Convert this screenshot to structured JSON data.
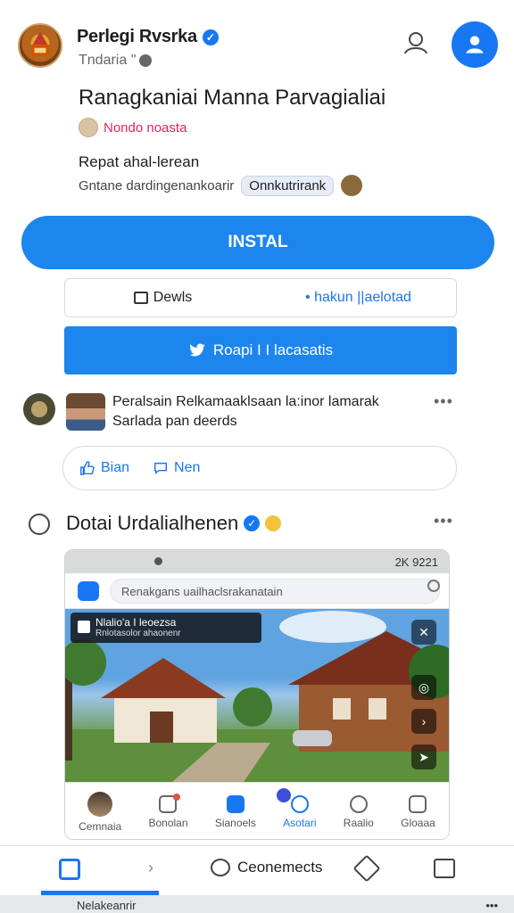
{
  "header": {
    "app_name": "Perlegi Rvsrka",
    "verified_icon": "verified-check-icon",
    "subtitle": "Tndaria \"",
    "globe_icon": "globe-icon",
    "profile_icon": "person-outline-icon",
    "account_icon": "person-circle-icon"
  },
  "headline": "Ranagkaniai Manna Parvagialiai",
  "tag_line": "Nondo noasta",
  "description": {
    "line1": "Repat ahal-lerean",
    "line2": "Gntane dardingenankoarir",
    "pill": "Onnkutrirank"
  },
  "install_button": "INSTAL",
  "split_box": {
    "left_label": "Dewls",
    "left_icon": "copy-icon",
    "right_label": "• hakun ||aelotad"
  },
  "share_button": {
    "label": "Roapi I I lacasatis",
    "icon": "bird-icon"
  },
  "post": {
    "line1": "Peralsain Relkamaaklsaan la:inor lamarak",
    "line2": "Sarlada pan deerds",
    "more": "•••"
  },
  "reactions": {
    "like_label": "Bian",
    "like_icon": "thumbs-up-icon",
    "comment_label": "Nen",
    "comment_icon": "speech-bubble-icon"
  },
  "section": {
    "title": "Dotai Urdalialhenen",
    "clock_icon": "clock-icon",
    "more": "•••"
  },
  "embedded": {
    "status_time": "2K 9221",
    "url_text": "Renakgans uailhaclsrakanatain",
    "banner_title": "Nlalio'a I leoezsa",
    "banner_sub": "Rnlotasolor ahaonenr",
    "nav": [
      {
        "label": "Cemnaia",
        "icon": "avatar-icon"
      },
      {
        "label": "Bonolan",
        "icon": "chat-add-icon"
      },
      {
        "label": "Sianoels",
        "icon": "message-icon"
      },
      {
        "label": "Asotari",
        "icon": "people-icon"
      },
      {
        "label": "Raalio",
        "icon": "heart-outline-icon"
      },
      {
        "label": "Gloaaa",
        "icon": "square-icon"
      }
    ]
  },
  "bottom_nav": {
    "home_icon": "home-icon",
    "comments_label": "Ceonemects",
    "tag_icon": "tag-icon",
    "frame_icon": "frame-icon"
  },
  "system_strip": {
    "left": "Nelakeanrir",
    "right": "•••"
  },
  "colors": {
    "accent": "#1877f2",
    "install": "#1c86ee",
    "tag_red": "#e0245e"
  }
}
